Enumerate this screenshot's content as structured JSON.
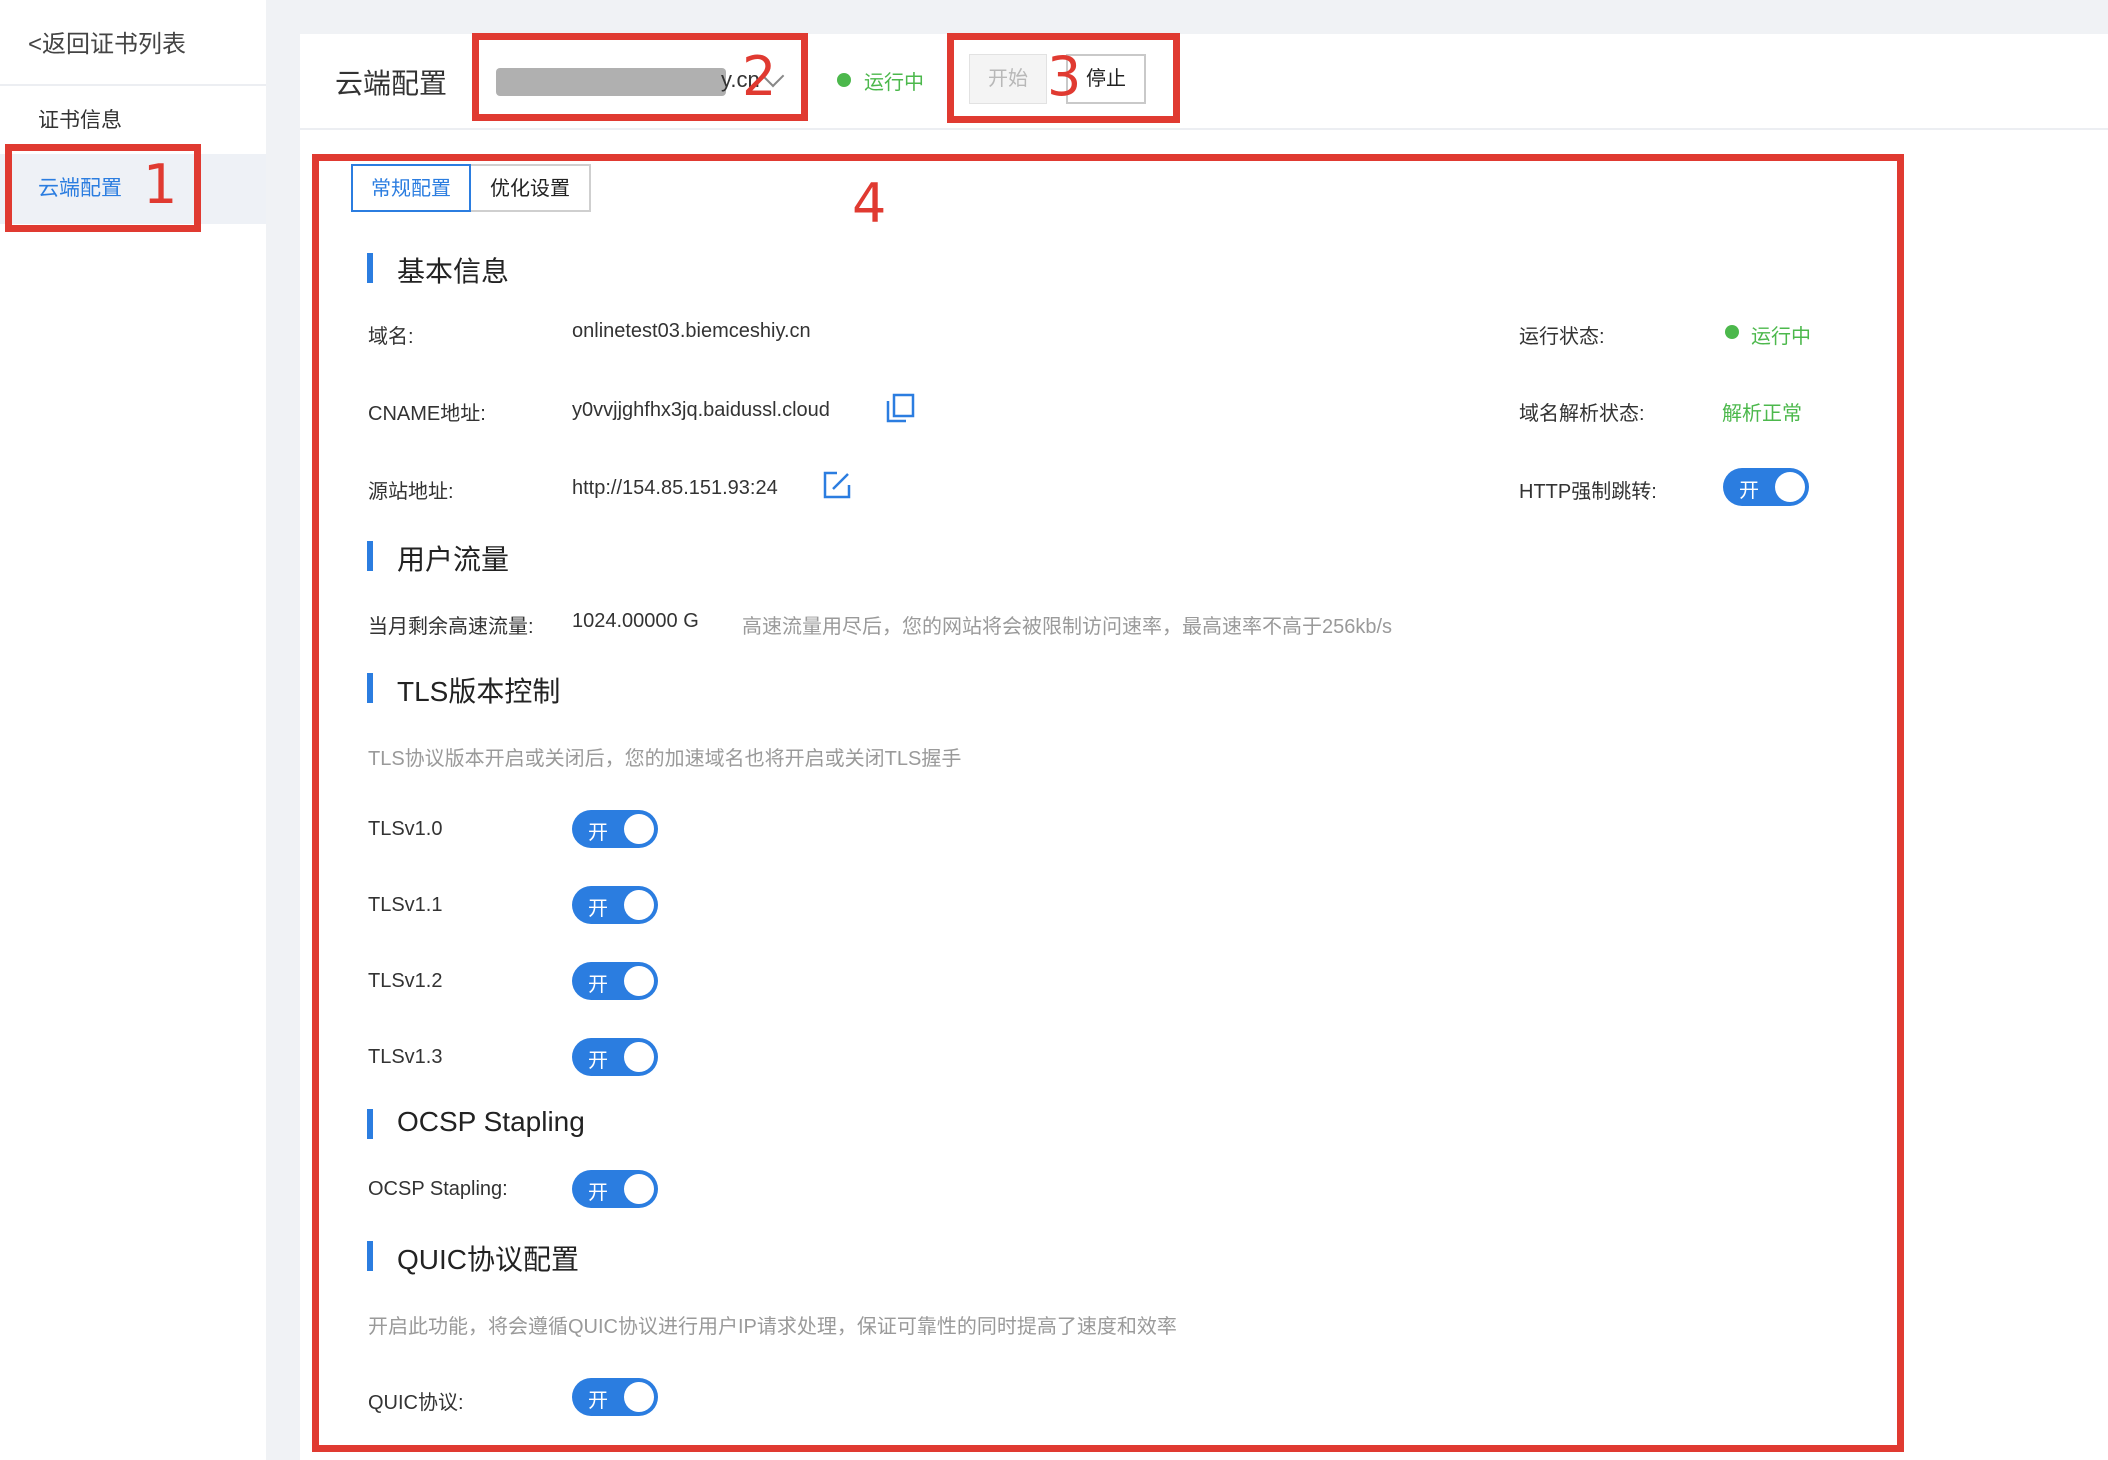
{
  "sidebar": {
    "back_label": "<返回证书列表",
    "items": [
      {
        "label": "证书信息"
      },
      {
        "label": "云端配置"
      }
    ]
  },
  "header": {
    "title": "云端配置",
    "domain_suffix": "y.cn",
    "status": "运行中",
    "start_label": "开始",
    "stop_label": "停止"
  },
  "tabs": [
    {
      "label": "常规配置"
    },
    {
      "label": "优化设置"
    }
  ],
  "basic": {
    "title": "基本信息",
    "domain_label": "域名:",
    "domain_value": "onlinetest03.biemceshiy.cn",
    "cname_label": "CNAME地址:",
    "cname_value": "y0vvjjghfhx3jq.baidussl.cloud",
    "origin_label": "源站地址:",
    "origin_value": "http://154.85.151.93:24",
    "run_status_label": "运行状态:",
    "run_status_value": "运行中",
    "dns_status_label": "域名解析状态:",
    "dns_status_value": "解析正常",
    "http_redirect_label": "HTTP强制跳转:",
    "http_redirect_toggle": "开"
  },
  "traffic": {
    "title": "用户流量",
    "remaining_label": "当月剩余高速流量:",
    "remaining_value": "1024.00000 G",
    "hint": "高速流量用尽后，您的网站将会被限制访问速率，最高速率不高于256kb/s"
  },
  "tls": {
    "title": "TLS版本控制",
    "hint": "TLS协议版本开启或关闭后，您的加速域名也将开启或关闭TLS握手",
    "versions": [
      {
        "label": "TLSv1.0",
        "toggle": "开"
      },
      {
        "label": "TLSv1.1",
        "toggle": "开"
      },
      {
        "label": "TLSv1.2",
        "toggle": "开"
      },
      {
        "label": "TLSv1.3",
        "toggle": "开"
      }
    ]
  },
  "ocsp": {
    "title": "OCSP Stapling",
    "label": "OCSP Stapling:",
    "toggle": "开"
  },
  "quic": {
    "title": "QUIC协议配置",
    "hint": "开启此功能，将会遵循QUIC协议进行用户IP请求处理，保证可靠性的同时提高了速度和效率",
    "label": "QUIC协议:",
    "toggle": "开"
  },
  "annotations": [
    "1",
    "2",
    "3",
    "4"
  ],
  "colors": {
    "accent": "#2b7de0",
    "success": "#4cb84c",
    "annotation": "#e03a31"
  }
}
